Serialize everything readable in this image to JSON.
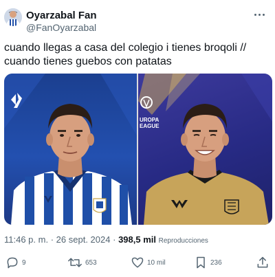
{
  "author": {
    "name": "Oyarzabal Fan",
    "handle": "@FanOyarzabal"
  },
  "tweet": {
    "text": "cuando llegas a casa del colegio i tienes broqoli // cuando tienes guebos con patatas",
    "time": "11:46 p. m.",
    "separator": "·",
    "date": "26 sept. 2024",
    "views_count": "398,5 mil",
    "views_label": "Reproducciones"
  },
  "media": {
    "left_photo": {
      "logo_glyph": "L"
    },
    "right_photo": {
      "logo_text_1": "UROPA",
      "logo_text_2": "EAGUE"
    }
  },
  "actions": {
    "reply_count": "9",
    "retweet_count": "653",
    "like_count": "10 mil",
    "bookmark_count": "236"
  },
  "colors": {
    "text_primary": "#0f1419",
    "text_secondary": "#536471",
    "left_bg": "#2350b0",
    "right_bg": "#272a84",
    "home_kit_blue": "#1f4fa8",
    "away_kit_gold": "#c7a45a"
  }
}
